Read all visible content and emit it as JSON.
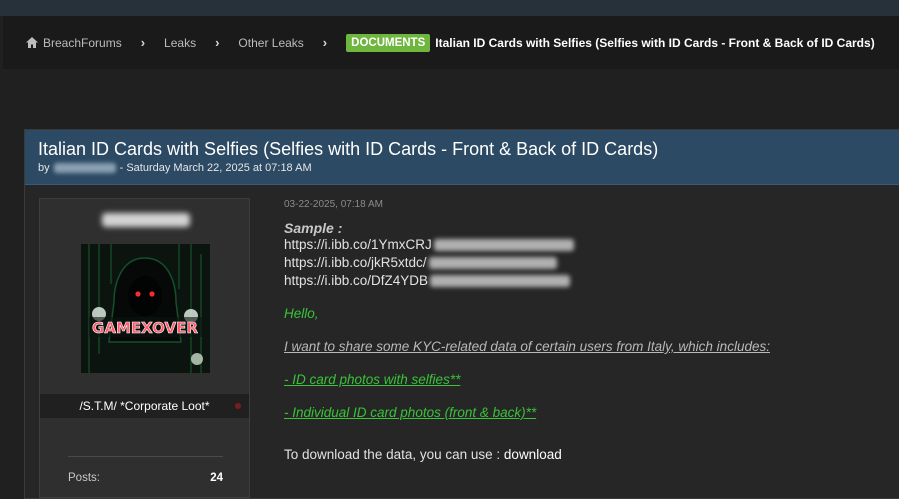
{
  "breadcrumb": {
    "home": "BreachForums",
    "items": [
      "Leaks",
      "Other Leaks"
    ],
    "tag": "DOCUMENTS",
    "current": "Italian ID Cards with Selfies (Selfies with ID Cards - Front & Back of ID Cards)"
  },
  "thread": {
    "title": "Italian ID Cards with Selfies (Selfies with ID Cards - Front & Back of ID Cards)",
    "by_prefix": "by",
    "date_meta": "- Saturday March 22, 2025 at 07:18 AM"
  },
  "user": {
    "avatar_text": "GAMEXOVER",
    "title": "/S.T.M/ *Corporate Loot*",
    "stats": [
      {
        "label": "Posts:",
        "value": "24"
      }
    ]
  },
  "post": {
    "date": "03-22-2025, 07:18 AM",
    "sample_label": "Sample :",
    "links": [
      "https://i.ibb.co/1YmxCRJ",
      "https://i.ibb.co/jkR5xtdc/",
      "https://i.ibb.co/DfZ4YDB"
    ],
    "greeting": "Hello,",
    "intro": "I want to share some KYC-related data of certain users from Italy, which includes:",
    "items": [
      "- ID card photos with selfies**",
      "- Individual ID card photos (front & back)**"
    ],
    "download_text": "To download the data, you can use :",
    "download_link": "download"
  },
  "colors": {
    "tag": "#6fb63f",
    "header": "#2c4a63",
    "green_text": "#39c339"
  },
  "icons": [
    "home-icon",
    "chevron-right-icon",
    "status-dot-icon"
  ]
}
